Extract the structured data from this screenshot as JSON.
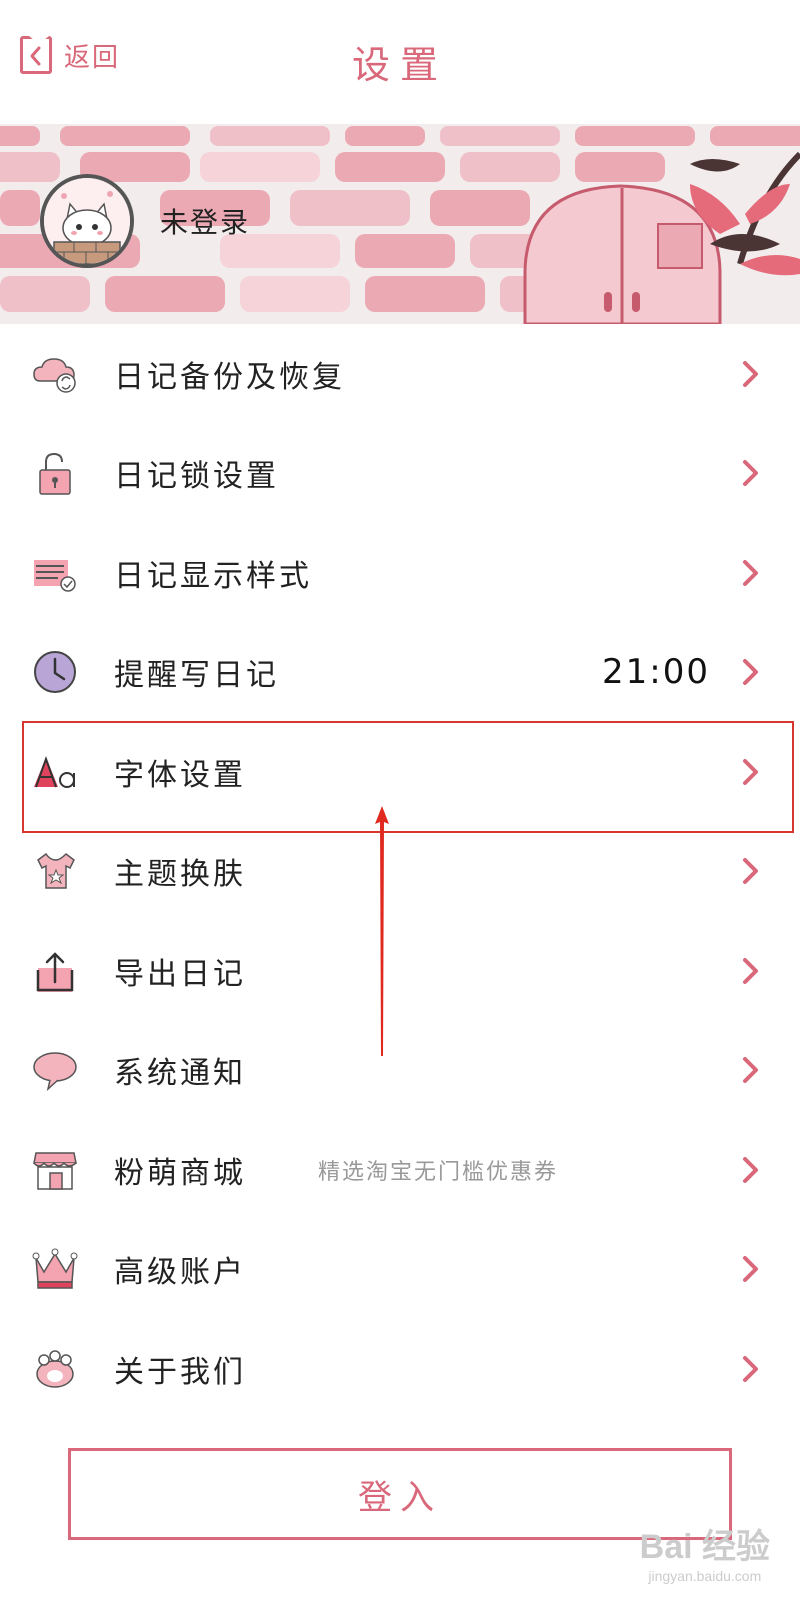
{
  "header": {
    "back_label": "返回",
    "title": "设置"
  },
  "profile": {
    "username": "未登录"
  },
  "menu": {
    "items": [
      {
        "label": "日记备份及恢复",
        "icon": "cloud-sync-icon"
      },
      {
        "label": "日记锁设置",
        "icon": "lock-icon"
      },
      {
        "label": "日记显示样式",
        "icon": "list-style-icon"
      },
      {
        "label": "提醒写日记",
        "icon": "clock-icon",
        "value": "21:00"
      },
      {
        "label": "字体设置",
        "icon": "font-icon"
      },
      {
        "label": "主题换肤",
        "icon": "tshirt-icon"
      },
      {
        "label": "导出日记",
        "icon": "export-icon"
      },
      {
        "label": "系统通知",
        "icon": "chat-bubble-icon"
      },
      {
        "label": "粉萌商城",
        "icon": "shop-icon",
        "subtitle": "精选淘宝无门槛优惠券"
      },
      {
        "label": "高级账户",
        "icon": "crown-icon"
      },
      {
        "label": "关于我们",
        "icon": "paw-icon"
      }
    ]
  },
  "login": {
    "label": "登入"
  },
  "watermark": {
    "main": "Bai 经验",
    "sub": "jingyan.baidu.com"
  },
  "colors": {
    "accent": "#d9687a",
    "brick_pink": "#eba9b4",
    "highlight_red": "#d8372f"
  }
}
